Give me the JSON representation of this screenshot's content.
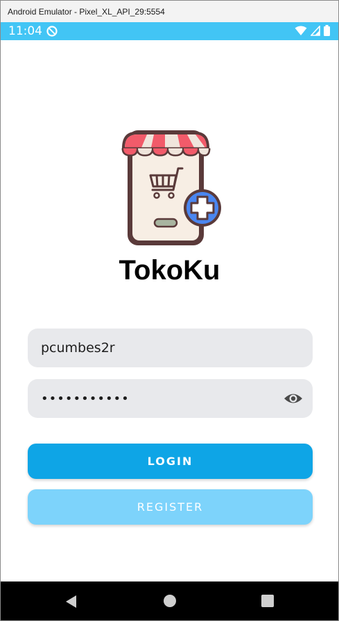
{
  "window": {
    "title": "Android Emulator - Pixel_XL_API_29:5554"
  },
  "status_bar": {
    "time": "11:04",
    "background_color": "#42c5f5",
    "icons": [
      "sync-icon",
      "wifi-icon",
      "signal-icon",
      "battery-icon"
    ]
  },
  "app": {
    "logo_icon": "shop-cart-add-icon",
    "title": "TokoKu"
  },
  "login_form": {
    "username_value": "pcumbes2r",
    "password_value": "•••••••••••",
    "password_toggle_icon": "eye-icon",
    "login_label": "LOGIN",
    "register_label": "REGISTER"
  },
  "colors": {
    "login_button": "#0ea5e6",
    "register_button": "#7dd3fb",
    "field_background": "#e8e9ec"
  },
  "nav_bar": {
    "icons": [
      "back-icon",
      "home-icon",
      "recents-icon"
    ]
  }
}
